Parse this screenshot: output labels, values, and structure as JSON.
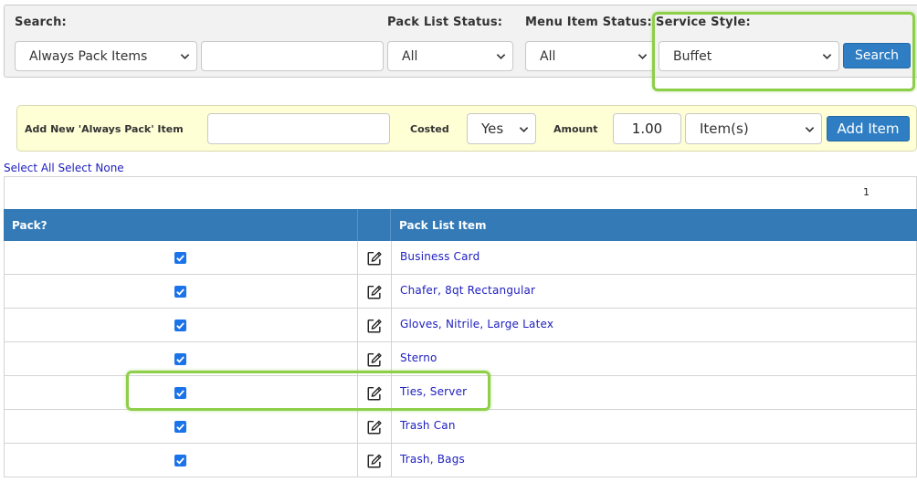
{
  "search": {
    "label": "Search:",
    "type_value": "Always Pack Items",
    "text_value": "",
    "pack_status_label": "Pack List Status:",
    "pack_status_value": "All",
    "menu_status_label": "Menu Item Status:",
    "menu_status_value": "All",
    "service_style_label": "Service Style:",
    "service_style_value": "Buffet",
    "search_button": "Search"
  },
  "add_item": {
    "label": "Add New 'Always Pack' Item",
    "name_value": "",
    "costed_label": "Costed",
    "costed_value": "Yes",
    "amount_label": "Amount",
    "amount_value": "1.00",
    "unit_value": "Item(s)",
    "add_button": "Add Item"
  },
  "links": {
    "select_all": "Select All",
    "select_none": "Select None"
  },
  "table": {
    "page": "1",
    "col_pack": "Pack?",
    "col_item": "Pack List Item",
    "rows": [
      {
        "name": "Business Card",
        "checked": true
      },
      {
        "name": "Chafer, 8qt Rectangular",
        "checked": true
      },
      {
        "name": "Gloves, Nitrile, Large Latex",
        "checked": true
      },
      {
        "name": "Sterno",
        "checked": true
      },
      {
        "name": "Ties, Server",
        "checked": true
      },
      {
        "name": "Trash Can",
        "checked": true
      },
      {
        "name": "Trash, Bags",
        "checked": true
      }
    ]
  },
  "colors": {
    "header_blue": "#337ab7",
    "button_blue": "#2f7ec3",
    "highlight_green": "#8ecf4a",
    "add_panel_bg": "#ffffd6",
    "link_blue": "#2020c0"
  }
}
